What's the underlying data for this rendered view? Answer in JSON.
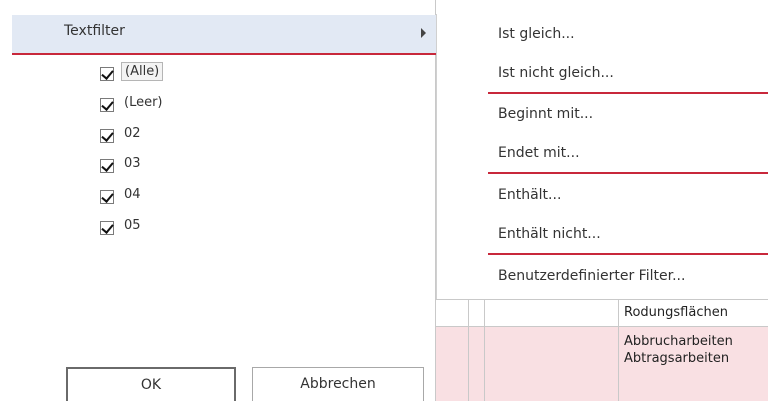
{
  "filter_panel": {
    "textfilter_label": "Textfilter",
    "items": [
      {
        "label": "(Alle)",
        "checked": true
      },
      {
        "label": "(Leer)",
        "checked": true
      },
      {
        "label": "02",
        "checked": true
      },
      {
        "label": "03",
        "checked": true
      },
      {
        "label": "04",
        "checked": true
      },
      {
        "label": "05",
        "checked": true
      }
    ],
    "ok_label": "OK",
    "cancel_label": "Abbrechen"
  },
  "submenu": {
    "items": [
      "Ist gleich...",
      "Ist nicht gleich...",
      "Beginnt mit...",
      "Endet mit...",
      "Enthält...",
      "Enthält nicht...",
      "Benutzerdefinierter Filter..."
    ]
  },
  "grid": {
    "header_cell": "Rodungsflächen",
    "body_line1": "Abbrucharbeiten",
    "body_line2": "Abtragsarbeiten"
  },
  "colors": {
    "accent_line": "#c8283b",
    "selected_row": "#e2e9f4",
    "highlight_row": "#f9e0e3"
  }
}
